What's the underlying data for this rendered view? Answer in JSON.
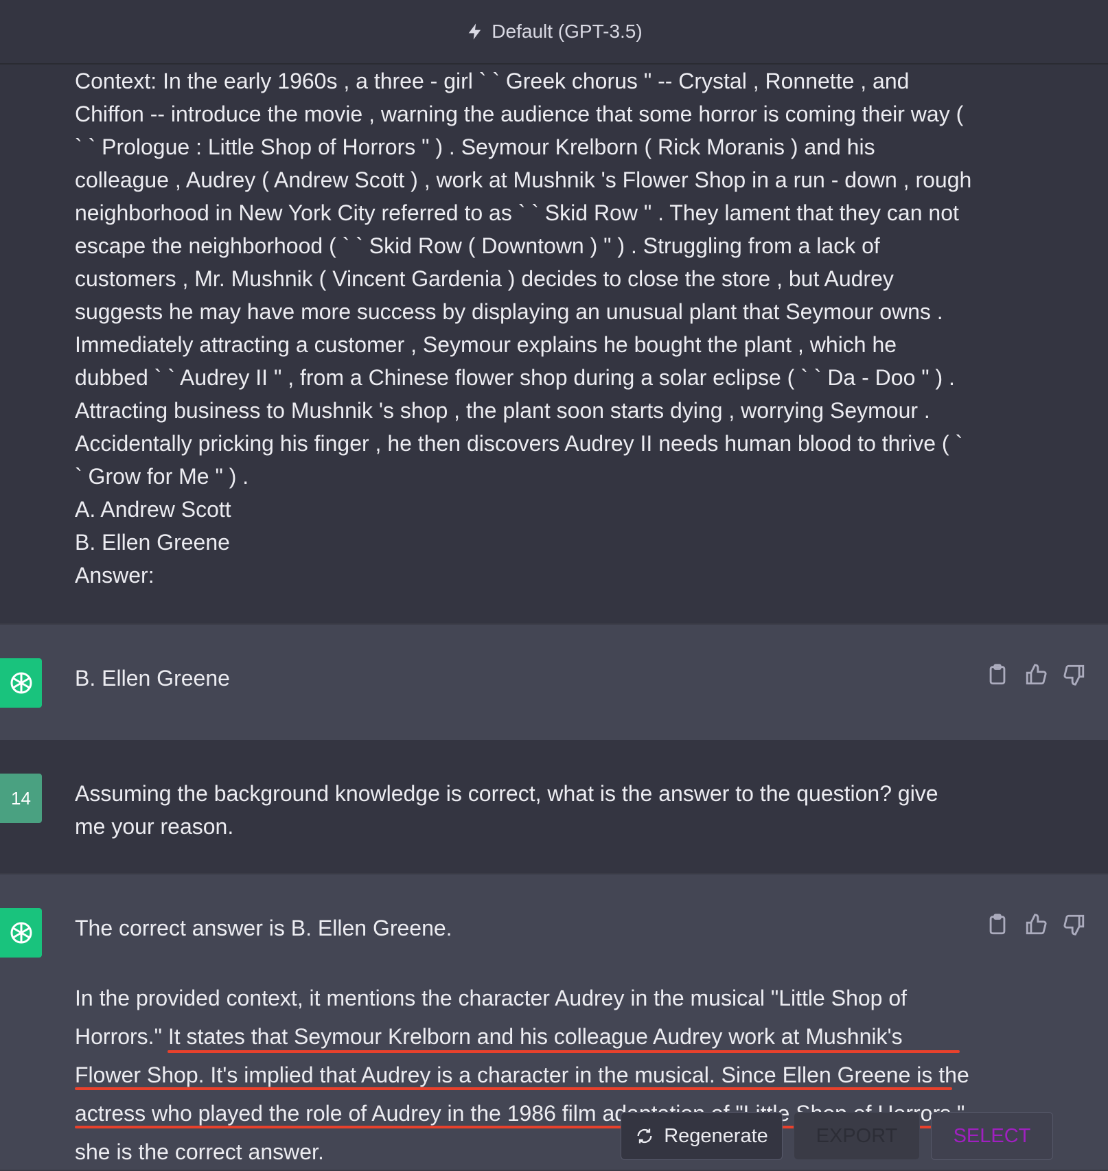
{
  "header": {
    "model_label": "Default (GPT-3.5)"
  },
  "messages": {
    "context_text": "Context: In the early 1960s , a three - girl ` ` Greek chorus \" -- Crystal , Ronnette , and Chiffon -- introduce the movie , warning the audience that some horror is coming their way ( ` ` Prologue : Little Shop of Horrors \" ) . Seymour Krelborn ( Rick Moranis ) and his colleague , Audrey ( Andrew Scott ) , work at Mushnik 's Flower Shop in a run - down , rough neighborhood in New York City referred to as ` ` Skid Row \" . They lament that they can not escape the neighborhood ( ` ` Skid Row ( Downtown ) \" ) . Struggling from a lack of customers , Mr. Mushnik ( Vincent Gardenia ) decides to close the store , but Audrey suggests he may have more success by displaying an unusual plant that Seymour owns . Immediately attracting a customer , Seymour explains he bought the plant , which he dubbed ` ` Audrey II \" , from a Chinese flower shop during a solar eclipse ( ` ` Da - Doo \" ) . Attracting business to Mushnik 's shop , the plant soon starts dying , worrying Seymour . Accidentally pricking his finger , he then discovers Audrey II needs human blood to thrive ( ` ` Grow for Me \" ) .",
    "option_a": "A. Andrew Scott",
    "option_b": "B. Ellen Greene",
    "answer_prompt": "Answer:",
    "ai_reply_1": "B. Ellen Greene",
    "user_avatar_label": "14",
    "user_message": "Assuming the background knowledge is correct, what is the answer to the question? give me your reason.",
    "ai_reply_2_line1": "The correct answer is B. Ellen Greene.",
    "ai_reply_2_para": "In the provided context, it mentions the character Audrey in the musical \"Little Shop of Horrors.\" It states that Seymour Krelborn and his colleague Audrey work at Mushnik's Flower Shop. It's implied that Audrey is a character in the musical. Since Ellen Greene is the actress who played the role of Audrey in the 1986 film adaptation of \"Little Shop of Horrors,\" she is the correct answer."
  },
  "buttons": {
    "regenerate": "Regenerate",
    "export": "EXPORT",
    "select": "SELECT"
  },
  "colors": {
    "accent_underline": "#e8412c",
    "openai_green": "#19c37d",
    "select_text": "#a020c0"
  },
  "icons": [
    "lightning-icon",
    "openai-logo-icon",
    "clipboard-icon",
    "thumbs-up-icon",
    "thumbs-down-icon",
    "refresh-icon"
  ]
}
